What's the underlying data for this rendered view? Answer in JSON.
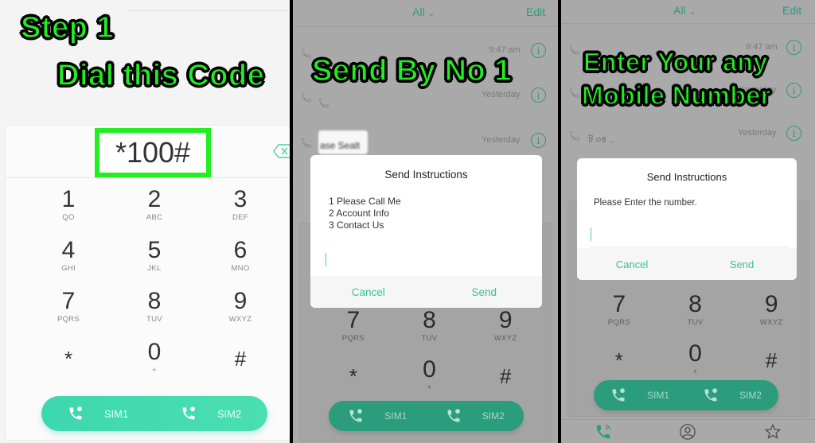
{
  "panel1": {
    "caption_line1": "Step 1",
    "caption_line2": "Dial this Code",
    "dial_input_value": "*100#",
    "keypad": [
      {
        "num": "1",
        "sub": "QO"
      },
      {
        "num": "2",
        "sub": "ABC"
      },
      {
        "num": "3",
        "sub": "DEF"
      },
      {
        "num": "4",
        "sub": "GHI"
      },
      {
        "num": "5",
        "sub": "JKL"
      },
      {
        "num": "6",
        "sub": "MNO"
      },
      {
        "num": "7",
        "sub": "PQRS"
      },
      {
        "num": "8",
        "sub": "TUV"
      },
      {
        "num": "9",
        "sub": "WXYZ"
      },
      {
        "num": "*",
        "sub": ""
      },
      {
        "num": "0",
        "sub": "+"
      },
      {
        "num": "#",
        "sub": ""
      }
    ],
    "sim_buttons": [
      "SIM1",
      "SIM2"
    ],
    "accent_color": "#22ee22",
    "sim_bar_color": "#3ed7ae"
  },
  "panel2": {
    "caption": "Send By No 1",
    "topbar": {
      "filter_label": "All",
      "edit_label": "Edit"
    },
    "call_log": [
      {
        "time": "9:47 am"
      },
      {
        "time": "Yesterday"
      },
      {
        "time": "Yesterday",
        "snippet": "ase Sealt"
      }
    ],
    "dialog": {
      "title": "Send Instructions",
      "options": [
        "1 Please Call Me",
        "2 Account Info",
        "3 Contact Us"
      ],
      "input_value": "",
      "cancel_label": "Cancel",
      "send_label": "Send"
    },
    "keypad": [
      {
        "num": "7",
        "sub": "PQRS"
      },
      {
        "num": "8",
        "sub": "TUV"
      },
      {
        "num": "9",
        "sub": "WXYZ"
      },
      {
        "num": "*",
        "sub": ""
      },
      {
        "num": "0",
        "sub": "+"
      },
      {
        "num": "#",
        "sub": ""
      }
    ],
    "sim_buttons": [
      "SIM1",
      "SIM2"
    ]
  },
  "panel3": {
    "caption_line1": "Enter Your any",
    "caption_line2": "Mobile Number",
    "topbar": {
      "filter_label": "All",
      "edit_label": "Edit"
    },
    "call_log": [
      {
        "time": "9:47 am"
      },
      {
        "time": "Yesterday"
      },
      {
        "time": "Yesterday",
        "snippet": "ট ৩৪ .."
      }
    ],
    "dialog": {
      "title": "Send Instructions",
      "message": "Please Enter the number.",
      "input_value": "",
      "cancel_label": "Cancel",
      "send_label": "Send"
    },
    "keypad": [
      {
        "num": "7",
        "sub": "PQRS"
      },
      {
        "num": "8",
        "sub": "TUV"
      },
      {
        "num": "9",
        "sub": "WXYZ"
      },
      {
        "num": "*",
        "sub": ""
      },
      {
        "num": "0",
        "sub": "+"
      },
      {
        "num": "#",
        "sub": ""
      }
    ],
    "sim_buttons": [
      "SIM1",
      "SIM2"
    ],
    "bottom_nav": [
      "phone-icon",
      "contacts-icon",
      "favorites-icon"
    ]
  }
}
